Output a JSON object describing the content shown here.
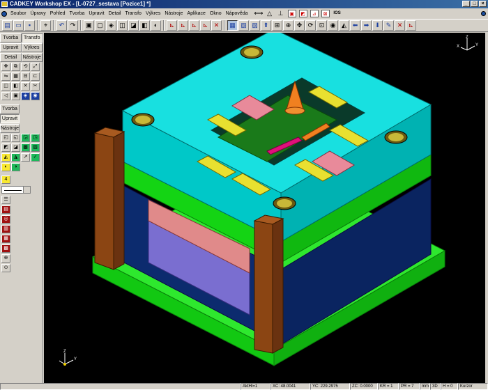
{
  "window": {
    "title": "CADKEY Workshop EX - [L-0727_sestava [Pozice1] *]",
    "btn_min": "_",
    "btn_max": "□",
    "btn_close": "×"
  },
  "menu": [
    "Soubor",
    "Úpravy",
    "Pohled",
    "Tvorba",
    "Upravit",
    "Detail",
    "Transfo",
    "Výkres",
    "Nástroje",
    "Aplikace",
    "Okno",
    "Nápověda"
  ],
  "menu_tool_ios": "IOS",
  "left_panel": {
    "tabs_top": [
      "Tvorba",
      "Transfo",
      "Upravit",
      "Výkres",
      "Detail",
      "Nástroje"
    ],
    "tabs_mid": [
      "Tvorba",
      "Upravit",
      "Nástroje"
    ],
    "color_value": "4"
  },
  "status": {
    "akthl": "AktHl=1",
    "xc": "XC: 48.0041",
    "yc": "YC: 229.2975",
    "zc": "ZC: 0.0000",
    "kr": "KR = 1",
    "pr": "PR = 7",
    "mm": "mm",
    "mode": "3D",
    "h": "H = 0",
    "cursor": "Kurzor"
  },
  "colors": {
    "cyan": "#00d6d6",
    "green": "#12d812",
    "navy": "#0c2b6e",
    "brown": "#8b4513",
    "pink": "#e88a8a",
    "yellow": "#e8e030",
    "orange": "#f08020",
    "magenta": "#e0107a"
  }
}
